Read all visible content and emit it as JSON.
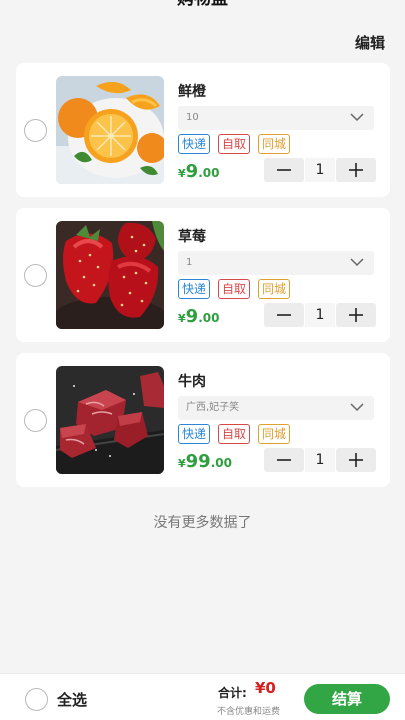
{
  "header": {
    "title": "购物盘",
    "edit_label": "编辑"
  },
  "items": [
    {
      "name": "鲜橙",
      "spec": "10",
      "price_int": "9",
      "price_dec": ".00",
      "quantity": "1",
      "image_icon": "orange-icon"
    },
    {
      "name": "草莓",
      "spec": "1",
      "price_int": "9",
      "price_dec": ".00",
      "quantity": "1",
      "image_icon": "strawberry-icon"
    },
    {
      "name": "牛肉",
      "spec": "广西,妃子笑",
      "price_int": "99",
      "price_dec": ".00",
      "quantity": "1",
      "image_icon": "beef-icon"
    }
  ],
  "tags": {
    "express": "快递",
    "pickup": "自取",
    "local": "同城"
  },
  "currency": "¥",
  "no_more": "没有更多数据了",
  "footer": {
    "select_all": "全选",
    "total_label": "合计:",
    "total_value": "¥0",
    "note": "不含优惠和运费",
    "checkout": "结算"
  },
  "colors": {
    "accent": "#32a544",
    "price": "#2f9e3e",
    "total": "#d62020",
    "tag_express": "#2a86d4",
    "tag_pickup": "#d84848",
    "tag_local": "#e0a030"
  }
}
